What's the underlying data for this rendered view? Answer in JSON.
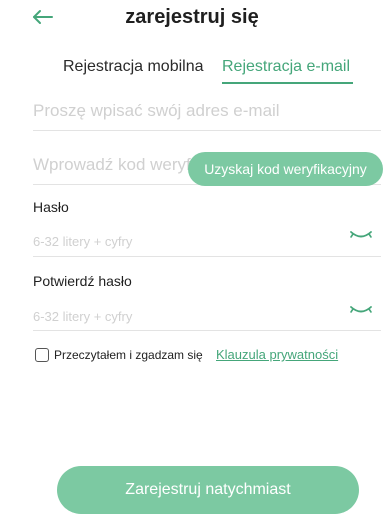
{
  "header": {
    "title": "zarejestruj się",
    "back_icon": "arrow-left-icon"
  },
  "tabs": {
    "mobile_label": "Rejestracja mobilna",
    "email_label": "Rejestracja e-mail",
    "active": "email"
  },
  "form": {
    "email": {
      "placeholder": "Proszę wpisać swój adres e-mail",
      "value": ""
    },
    "code": {
      "placeholder": "Wprowadź kod weryfikacyjny",
      "value": "",
      "button_label": "Uzyskaj kod weryfikacyjny"
    },
    "password": {
      "label": "Hasło",
      "placeholder": "6-32 litery + cyfry",
      "value": "",
      "visibility_icon": "eye-closed-icon"
    },
    "confirm_password": {
      "label": "Potwierdź hasło",
      "placeholder": "6-32 litery + cyfry",
      "value": "",
      "visibility_icon": "eye-closed-icon"
    }
  },
  "agreement": {
    "checked": false,
    "text": "Przeczytałem i zgadzam się",
    "link_label": "Klauzula prywatności"
  },
  "submit": {
    "label": "Zarejestruj natychmiast"
  },
  "colors": {
    "accent": "#45a67a",
    "button": "#7cc9a2",
    "placeholder": "#d0d0d0",
    "divider": "#e3e3e3"
  }
}
